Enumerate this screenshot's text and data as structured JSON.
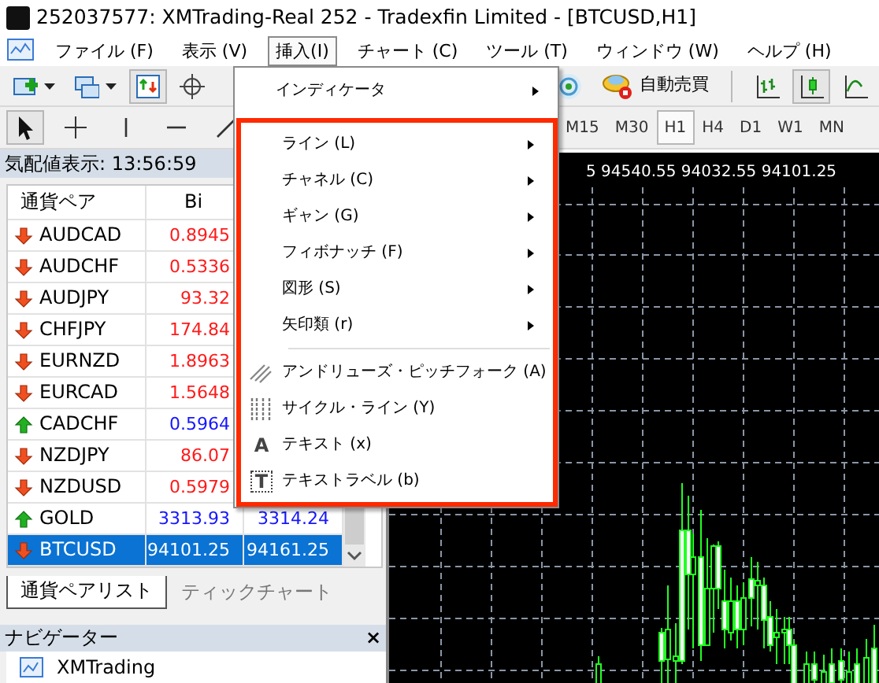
{
  "window": {
    "title": "252037577: XMTrading-Real 252 - Tradexfin Limited - [BTCUSD,H1]"
  },
  "menu_bar": [
    {
      "label": "ファイル (F)",
      "selected": false
    },
    {
      "label": "表示 (V)",
      "selected": false
    },
    {
      "label": "挿入(I)",
      "selected": true
    },
    {
      "label": "チャート (C)",
      "selected": false
    },
    {
      "label": "ツール (T)",
      "selected": false
    },
    {
      "label": "ウィンドウ (W)",
      "selected": false
    },
    {
      "label": "ヘルプ (H)",
      "selected": false
    }
  ],
  "toolbar": {
    "left": [
      {
        "kind": "new_chart",
        "selected": false
      },
      {
        "kind": "profiles",
        "selected": false
      },
      {
        "kind": "market_watch",
        "selected": true
      },
      {
        "kind": "crosshair",
        "selected": false
      }
    ],
    "auto_trading": "自動売買",
    "chart_types": [
      {
        "kind": "bars",
        "selected": false
      },
      {
        "kind": "candles",
        "selected": true
      },
      {
        "kind": "line",
        "selected": false
      }
    ]
  },
  "drawing_tools": [
    {
      "kind": "cursor",
      "selected": true
    },
    {
      "kind": "crosshair",
      "selected": false
    },
    {
      "kind": "vertical_line",
      "selected": false
    },
    {
      "kind": "horizontal_line",
      "selected": false
    },
    {
      "kind": "trendline",
      "selected": false
    }
  ],
  "timeframes": [
    {
      "label": "M15",
      "selected": false
    },
    {
      "label": "M30",
      "selected": false
    },
    {
      "label": "H1",
      "selected": true
    },
    {
      "label": "H4",
      "selected": false
    },
    {
      "label": "D1",
      "selected": false
    },
    {
      "label": "W1",
      "selected": false
    },
    {
      "label": "MN",
      "selected": false
    }
  ],
  "market_watch": {
    "title": "気配値表示: 13:56:59",
    "columns": [
      "通貨ペア",
      "Bi"
    ],
    "rows": [
      {
        "symbol": "AUDCAD",
        "rising": false,
        "bid": "0.8945",
        "selected": false
      },
      {
        "symbol": "AUDCHF",
        "rising": false,
        "bid": "0.5336",
        "selected": false
      },
      {
        "symbol": "AUDJPY",
        "rising": false,
        "bid": "93.32",
        "selected": false
      },
      {
        "symbol": "CHFJPY",
        "rising": false,
        "bid": "174.84",
        "selected": false
      },
      {
        "symbol": "EURNZD",
        "rising": false,
        "bid": "1.8963",
        "selected": false
      },
      {
        "symbol": "EURCAD",
        "rising": false,
        "bid": "1.5648",
        "selected": false
      },
      {
        "symbol": "CADCHF",
        "rising": true,
        "bid": "0.5964",
        "selected": false
      },
      {
        "symbol": "NZDJPY",
        "rising": false,
        "bid": "86.07",
        "selected": false
      },
      {
        "symbol": "NZDUSD",
        "rising": false,
        "bid": "0.5979",
        "selected": false
      },
      {
        "symbol": "GOLD",
        "rising": true,
        "bid": "3313.93",
        "ask": "3314.24",
        "selected": false
      },
      {
        "symbol": "BTCUSD",
        "rising": false,
        "bid": "94101.25",
        "ask": "94161.25",
        "selected": true
      }
    ],
    "tabs": [
      {
        "label": "通貨ペアリスト",
        "selected": true
      },
      {
        "label": "ティックチャート",
        "selected": false
      }
    ]
  },
  "navigator": {
    "title": "ナビゲーター",
    "close": "×",
    "items": [
      "XMTrading"
    ]
  },
  "chart": {
    "ohlc": "5 94540.55 94032.55 94101.25"
  },
  "insert_menu": {
    "sections": [
      {
        "highlighted": false,
        "items": [
          {
            "label": "インディケータ",
            "kind": "submenu"
          }
        ]
      },
      {
        "highlighted": true,
        "items": [
          {
            "label": "ライン (L)",
            "kind": "submenu"
          },
          {
            "label": "チャネル (C)",
            "kind": "submenu"
          },
          {
            "label": "ギャン (G)",
            "kind": "submenu"
          },
          {
            "label": "フィボナッチ (F)",
            "kind": "submenu"
          },
          {
            "label": "図形 (S)",
            "kind": "submenu"
          },
          {
            "label": "矢印類 (r)",
            "kind": "submenu"
          },
          {
            "label": "アンドリューズ・ピッチフォーク (A)",
            "kind": "pitchfork"
          },
          {
            "label": "サイクル・ライン (Y)",
            "kind": "cycle_lines"
          },
          {
            "label": "テキスト (x)",
            "kind": "text",
            "icon_glyph": "A"
          },
          {
            "label": "テキストラベル (b)",
            "kind": "text_label",
            "icon_glyph": "T"
          }
        ]
      }
    ]
  }
}
